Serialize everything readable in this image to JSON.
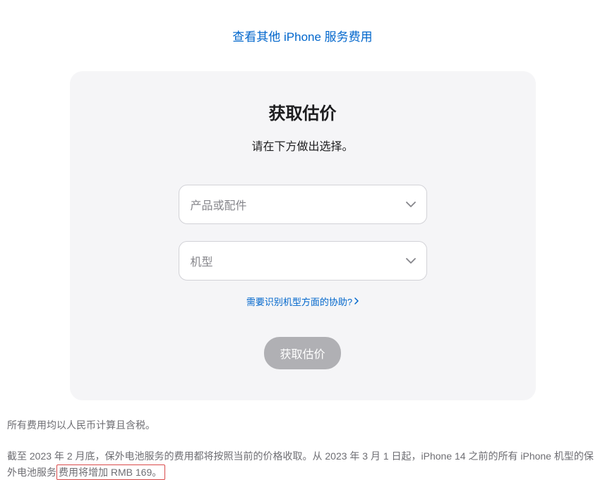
{
  "top_link": {
    "label": "查看其他 iPhone 服务费用"
  },
  "card": {
    "title": "获取估价",
    "subtitle": "请在下方做出选择。",
    "product_select": {
      "placeholder": "产品或配件"
    },
    "model_select": {
      "placeholder": "机型"
    },
    "help_link": {
      "label": "需要识别机型方面的协助?"
    },
    "submit_label": "获取估价"
  },
  "footnotes": {
    "line1": "所有费用均以人民币计算且含税。",
    "line2_pre": "截至 2023 年 2 月底，保外电池服务的费用都将按照当前的价格收取。从 2023 年 3 月 1 日起，iPhone 14 之前的所有 iPhone 机型的保外电池服务",
    "line2_highlight": "费用将增加 RMB 169。"
  }
}
